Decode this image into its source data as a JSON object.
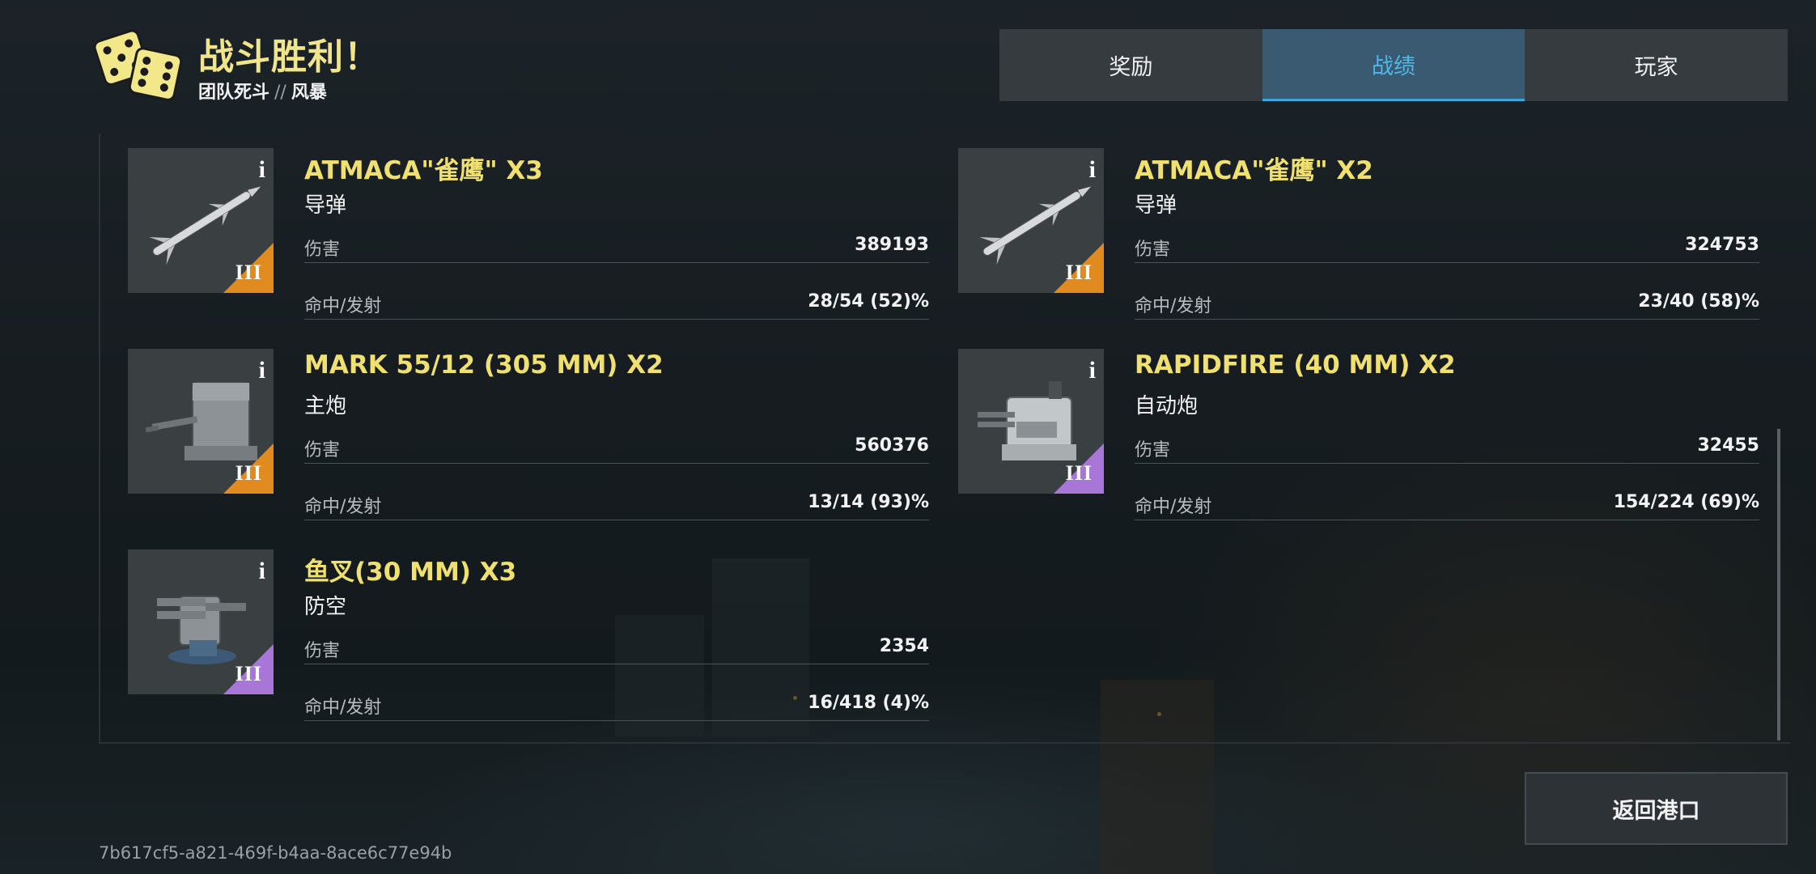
{
  "header": {
    "title": "战斗胜利！",
    "mode": "团队死斗",
    "separator": "//",
    "map": "风暴"
  },
  "tabs": [
    {
      "label": "奖励",
      "active": false
    },
    {
      "label": "战绩",
      "active": true
    },
    {
      "label": "玩家",
      "active": false
    }
  ],
  "weapons": [
    {
      "name": "ATMACA\"雀鹰\" X3",
      "type": "导弹",
      "damage_label": "伤害",
      "damage": "389193",
      "hits_label": "命中/发射",
      "hits": "28/54 (52)%",
      "tier": "III",
      "tier_color": "#e08a1f",
      "icon": "missile-icon"
    },
    {
      "name": "ATMACA\"雀鹰\" X2",
      "type": "导弹",
      "damage_label": "伤害",
      "damage": "324753",
      "hits_label": "命中/发射",
      "hits": "23/40 (58)%",
      "tier": "III",
      "tier_color": "#e08a1f",
      "icon": "missile-icon"
    },
    {
      "name": "MARK 55/12 (305 MM) X2",
      "type": "主炮",
      "damage_label": "伤害",
      "damage": "560376",
      "hits_label": "命中/发射",
      "hits": "13/14 (93)%",
      "tier": "III",
      "tier_color": "#e08a1f",
      "icon": "main-gun-turret-icon"
    },
    {
      "name": "RAPIDFIRE (40 MM) X2",
      "type": "自动炮",
      "damage_label": "伤害",
      "damage": "32455",
      "hits_label": "命中/发射",
      "hits": "154/224 (69)%",
      "tier": "III",
      "tier_color": "#a776d6",
      "icon": "autocannon-turret-icon"
    },
    {
      "name": "鱼叉(30 MM) X3",
      "type": "防空",
      "damage_label": "伤害",
      "damage": "2354",
      "hits_label": "命中/发射",
      "hits": "16/418 (4)%",
      "tier": "III",
      "tier_color": "#a776d6",
      "icon": "anti-air-turret-icon"
    }
  ],
  "info_glyph": "i",
  "return_button": "返回港口",
  "session_id": "7b617cf5-a821-469f-b4aa-8ace6c77e94b",
  "colors": {
    "title": "#f0e58a",
    "weapon_name": "#f0e070",
    "active_tab_text": "#4fb8ea",
    "active_tab_bg": "#395a70"
  }
}
